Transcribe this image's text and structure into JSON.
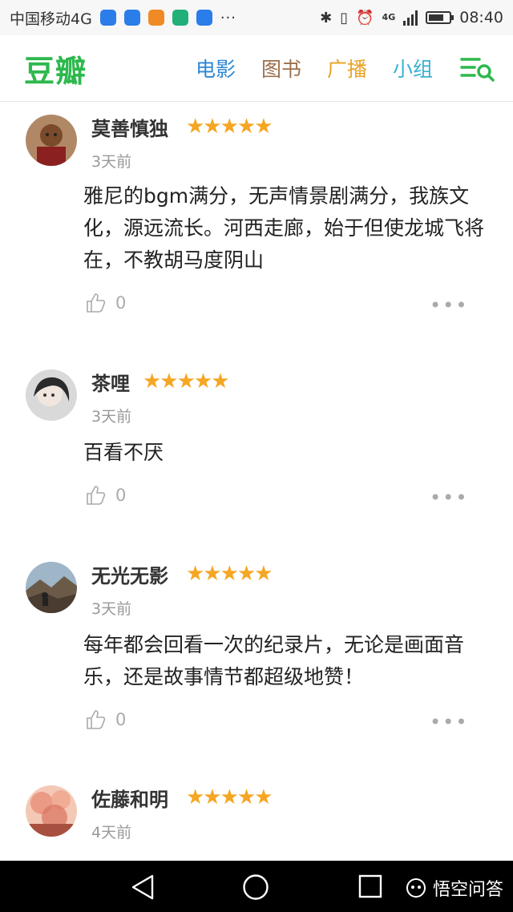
{
  "status_bar": {
    "carrier": "中国移动4G",
    "dots": "···",
    "network": "4G",
    "battery_level": 0.75,
    "time": "08:40",
    "app_icon_colors": [
      "#2b7de9",
      "#2b7de9",
      "#f08a24",
      "#21b07a",
      "#2b7de9"
    ]
  },
  "header": {
    "logo": "豆瓣",
    "nav": [
      {
        "label": "电影",
        "color": "#2d87d6"
      },
      {
        "label": "图书",
        "color": "#9c6f4c"
      },
      {
        "label": "广播",
        "color": "#e9a426"
      },
      {
        "label": "小组",
        "color": "#3ab0d2"
      }
    ],
    "menu_icon_color": "#2db84d"
  },
  "comments": [
    {
      "user": "莫善慎独",
      "stars": "★★★★★",
      "rating": 5,
      "time": "3天前",
      "text": "雅尼的bgm满分，无声情景剧满分，我族文化，源远流长。河西走廊，始于但使龙城飞将在，不教胡马度阴山",
      "likes": "0"
    },
    {
      "user": "茶哩",
      "stars": "★★★★★",
      "rating": 5,
      "time": "3天前",
      "text": "百看不厌",
      "likes": "0"
    },
    {
      "user": "无光无影",
      "stars": "★★★★★",
      "rating": 5,
      "time": "3天前",
      "text": "每年都会回看一次的纪录片，无论是画面音乐，还是故事情节都超级地赞！",
      "likes": "0"
    },
    {
      "user": "佐藤和明",
      "stars": "★★★★★",
      "rating": 5,
      "time": "4天前",
      "text": "",
      "likes": ""
    }
  ],
  "more_glyph": "•••",
  "watermark": {
    "text": "悟空问答"
  },
  "colors": {
    "star": "#f5a623",
    "brand_green": "#2db84d",
    "muted": "#999999"
  }
}
